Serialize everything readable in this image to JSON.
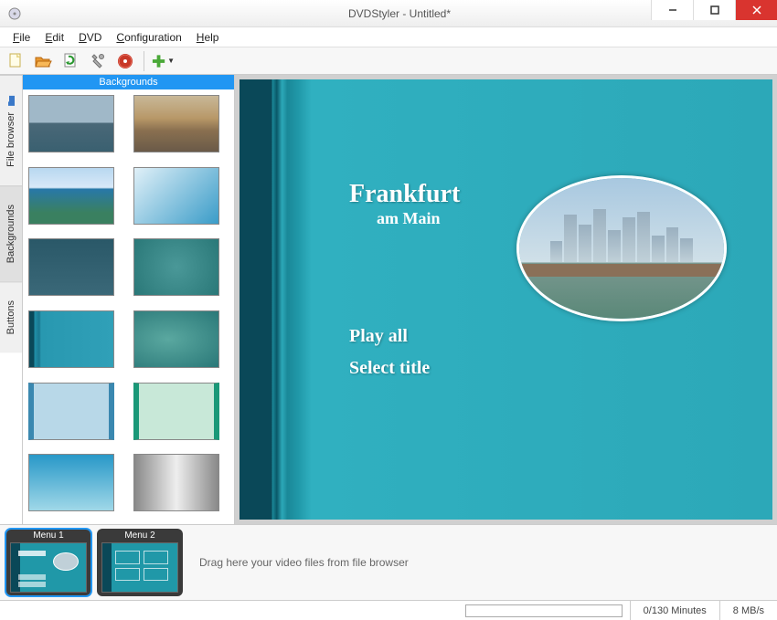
{
  "window": {
    "title": "DVDStyler - Untitled*"
  },
  "menubar": {
    "file": "File",
    "edit": "Edit",
    "dvd": "DVD",
    "configuration": "Configuration",
    "help": "Help"
  },
  "toolbar": {
    "new": "new-file-icon",
    "open": "open-folder-icon",
    "save": "save-refresh-icon",
    "settings": "wrench-icon",
    "burn": "burn-disc-icon",
    "add": "add-plus-icon"
  },
  "side_tabs": {
    "file_browser": "File browser",
    "backgrounds": "Backgrounds",
    "buttons": "Buttons"
  },
  "browser": {
    "header": "Backgrounds"
  },
  "thumbs": [
    "ocean",
    "sunset",
    "aerial",
    "gradient-blue",
    "dark-teal",
    "teal-noise",
    "stripes",
    "blurry",
    "lightblue-box",
    "mint-box",
    "blue-fade",
    "grey-shine"
  ],
  "dvd_menu": {
    "title": "Frankfurt",
    "subtitle": "am Main",
    "play_all": "Play all",
    "select_title": "Select title"
  },
  "timeline": {
    "menu1": "Menu 1",
    "menu2": "Menu 2",
    "drop_hint": "Drag here your video files from file browser"
  },
  "status": {
    "progress": "0/130 Minutes",
    "bitrate": "8 MB/s"
  }
}
